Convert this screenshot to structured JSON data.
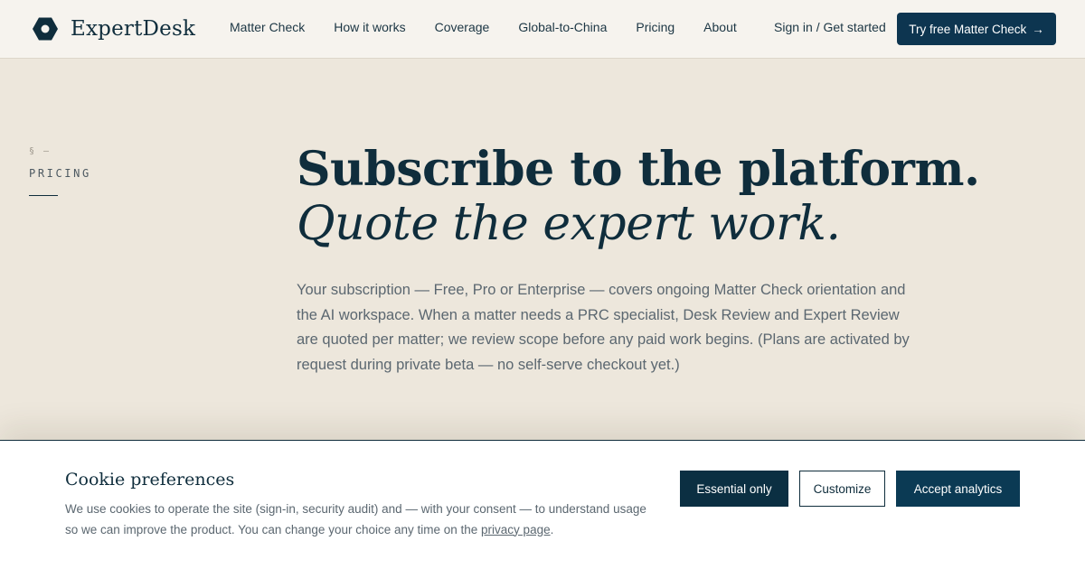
{
  "brand": {
    "name": "ExpertDesk",
    "logo_icon": "hexagon-logo-icon",
    "color": "#0f2d3c"
  },
  "nav": {
    "items": [
      {
        "label": "Matter Check"
      },
      {
        "label": "How it works"
      },
      {
        "label": "Coverage"
      },
      {
        "label": "Global-to-China"
      },
      {
        "label": "Pricing"
      },
      {
        "label": "About"
      }
    ],
    "signin_label": "Sign in / Get started",
    "cta_label": "Try free Matter Check",
    "cta_arrow": "→"
  },
  "section": {
    "mark": "§ —",
    "label": "PRICING"
  },
  "hero": {
    "title": "Subscribe to the platform.",
    "subtitle": "Quote the expert work.",
    "body": "Your subscription — Free, Pro or Enterprise — covers ongoing Matter Check orientation and the AI workspace. When a matter needs a PRC specialist, Desk Review and Expert Review are quoted per matter; we review scope before any paid work begins. (Plans are activated by request during private beta — no self-serve checkout yet.)"
  },
  "cookie": {
    "title": "Cookie preferences",
    "text_before_link": "We use cookies to operate the site (sign-in, security audit) and — with your consent — to understand usage so we can improve the product. You can change your choice any time on the ",
    "link_label": "privacy page",
    "text_after_link": ".",
    "buttons": {
      "essential": "Essential only",
      "customize": "Customize",
      "accept": "Accept analytics"
    }
  },
  "colors": {
    "accent": "#0d3550",
    "page_bg": "#ede7dc",
    "header_bg": "#f6f3ee",
    "body_text": "#5b6770"
  }
}
